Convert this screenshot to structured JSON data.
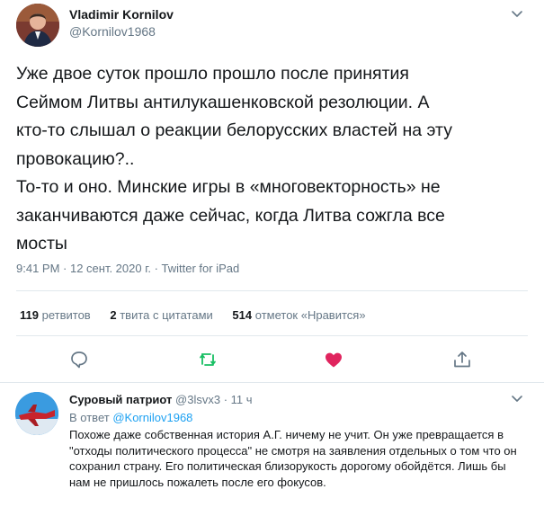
{
  "tweet": {
    "author_name": "Vladimir Kornilov",
    "author_handle": "@Kornilov1968",
    "text": "Уже двое суток прошло прошло после принятия\nСеймом Литвы антилукашенковской резолюции. А\nкто-то слышал о реакции белорусских властей на эту\nпровокацию?..\nТо-то и оно. Минские игры в «многовекторность» не\nзаканчиваются даже сейчас, когда Литва сожгла все\nмосты",
    "timestamp": "9:41 PM · 12 сент. 2020 г. · Twitter for iPad",
    "stats": {
      "retweets_count": "119",
      "retweets_label": "ретвитов",
      "quotes_count": "2",
      "quotes_label": "твита с цитатами",
      "likes_count": "514",
      "likes_label": "отметок «Нравится»"
    },
    "actions": [
      "reply-icon",
      "retweet-icon",
      "like-icon",
      "share-icon"
    ]
  },
  "reply": {
    "author_name": "Суровый патриот",
    "author_handle": "@3lsvx3",
    "time": "· 11 ч",
    "in_reply_prefix": "В ответ",
    "in_reply_handle": "@Kornilov1968",
    "text": "Похоже даже собственная история А.Г. ничему не учит. Он уже превращается в \"отходы политического процесса\" не смотря на заявления отдельных о том что он сохранил страну. Его политическая близорукость дорогому обойдётся. Лишь бы нам не пришлось пожалеть после его фокусов."
  },
  "colors": {
    "text": "#14171a",
    "secondary": "#657786",
    "link": "#1da1f2",
    "retweet_green": "#17bf63",
    "like_red": "#e0245e",
    "divider": "#e1e8ed"
  }
}
